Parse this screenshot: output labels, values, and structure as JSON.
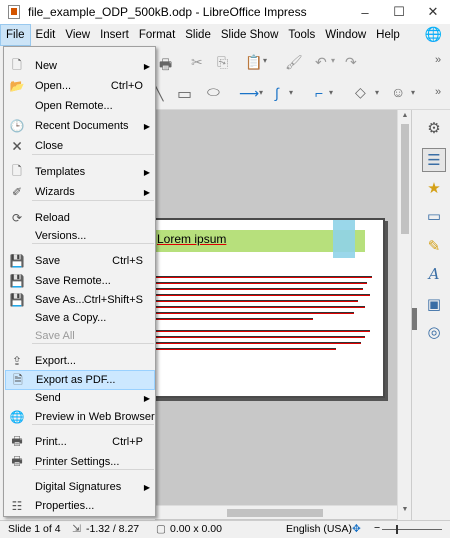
{
  "window": {
    "title": "file_example_ODP_500kB.odp - LibreOffice Impress",
    "minimize": "–",
    "maximize": "☐",
    "close": "✕"
  },
  "menubar": {
    "items": [
      "File",
      "Edit",
      "View",
      "Insert",
      "Format",
      "Slide",
      "Slide Show",
      "Tools",
      "Window",
      "Help"
    ]
  },
  "file_menu": {
    "items": [
      {
        "label": "New",
        "shortcut": "",
        "submenu": true,
        "icon": "new-document-icon",
        "enabled": true
      },
      {
        "label": "Open...",
        "shortcut": "Ctrl+O",
        "submenu": false,
        "icon": "folder-open-icon",
        "enabled": true
      },
      {
        "label": "Open Remote...",
        "shortcut": "",
        "submenu": false,
        "icon": "",
        "enabled": true
      },
      {
        "label": "Recent Documents",
        "shortcut": "",
        "submenu": true,
        "icon": "clock-icon",
        "enabled": true
      },
      {
        "label": "Close",
        "shortcut": "",
        "submenu": false,
        "icon": "close-document-icon",
        "enabled": true
      },
      {
        "label": "Templates",
        "shortcut": "",
        "submenu": true,
        "icon": "template-icon",
        "enabled": true
      },
      {
        "label": "Wizards",
        "shortcut": "",
        "submenu": true,
        "icon": "wizard-icon",
        "enabled": true
      },
      {
        "label": "Reload",
        "shortcut": "",
        "submenu": false,
        "icon": "reload-icon",
        "enabled": true
      },
      {
        "label": "Versions...",
        "shortcut": "",
        "submenu": false,
        "icon": "",
        "enabled": true
      },
      {
        "label": "Save",
        "shortcut": "Ctrl+S",
        "submenu": false,
        "icon": "save-icon",
        "enabled": true
      },
      {
        "label": "Save Remote...",
        "shortcut": "",
        "submenu": false,
        "icon": "save-remote-icon",
        "enabled": true
      },
      {
        "label": "Save As...",
        "shortcut": "Ctrl+Shift+S",
        "submenu": false,
        "icon": "save-as-icon",
        "enabled": true
      },
      {
        "label": "Save a Copy...",
        "shortcut": "",
        "submenu": false,
        "icon": "",
        "enabled": true
      },
      {
        "label": "Save All",
        "shortcut": "",
        "submenu": false,
        "icon": "",
        "enabled": false
      },
      {
        "label": "Export...",
        "shortcut": "",
        "submenu": false,
        "icon": "export-icon",
        "enabled": true
      },
      {
        "label": "Export as PDF...",
        "shortcut": "",
        "submenu": false,
        "icon": "pdf-icon",
        "enabled": true,
        "highlighted": true
      },
      {
        "label": "Send",
        "shortcut": "",
        "submenu": true,
        "icon": "",
        "enabled": true
      },
      {
        "label": "Preview in Web Browser",
        "shortcut": "",
        "submenu": false,
        "icon": "web-preview-icon",
        "enabled": true
      },
      {
        "label": "Print...",
        "shortcut": "Ctrl+P",
        "submenu": false,
        "icon": "printer-icon",
        "enabled": true
      },
      {
        "label": "Printer Settings...",
        "shortcut": "",
        "submenu": false,
        "icon": "printer-settings-icon",
        "enabled": true
      },
      {
        "label": "Digital Signatures",
        "shortcut": "",
        "submenu": true,
        "icon": "",
        "enabled": true
      },
      {
        "label": "Properties...",
        "shortcut": "",
        "submenu": false,
        "icon": "properties-icon",
        "enabled": true
      }
    ]
  },
  "slide": {
    "title": "Lorem ipsum"
  },
  "statusbar": {
    "slide": "Slide 1 of 4",
    "position": "-1.32 / 8.27",
    "size": "0.00 x 0.00",
    "language": "English (USA)"
  },
  "colors": {
    "title_bar_green": "#b7e07c",
    "accent_blue": "#8fd3e8",
    "menu_highlight": "#cce8ff"
  }
}
